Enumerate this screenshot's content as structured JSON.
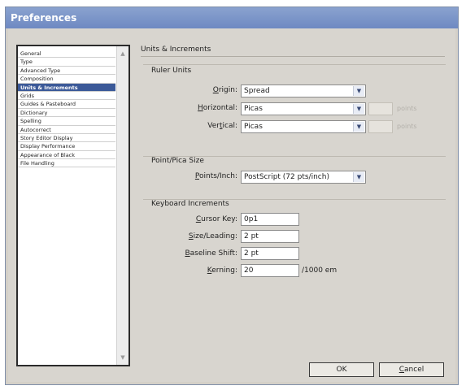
{
  "window": {
    "title": "Preferences"
  },
  "sidebar": {
    "items": [
      "General",
      "Type",
      "Advanced Type",
      "Composition",
      "Units & Increments",
      "Grids",
      "Guides & Pasteboard",
      "Dictionary",
      "Spelling",
      "Autocorrect",
      "Story Editor Display",
      "Display Performance",
      "Appearance of Black",
      "File Handling"
    ],
    "selected": "Units & Increments"
  },
  "panel": {
    "title": "Units & Increments",
    "ruler_units": {
      "title": "Ruler Units",
      "origin_label": "Origin:",
      "origin_value": "Spread",
      "horizontal_label": "Horizontal:",
      "horizontal_value": "Picas",
      "horizontal_points_label": "points",
      "vertical_label": "Vertical:",
      "vertical_value": "Picas",
      "vertical_points_label": "points"
    },
    "point_pica": {
      "title": "Point/Pica Size",
      "points_inch_label": "Points/Inch:",
      "points_inch_value": "PostScript (72 pts/inch)"
    },
    "keyboard": {
      "title": "Keyboard Increments",
      "cursor_key_label": "Cursor Key:",
      "cursor_key_value": "0p1",
      "size_leading_label": "Size/Leading:",
      "size_leading_value": "2 pt",
      "baseline_shift_label": "Baseline Shift:",
      "baseline_shift_value": "2 pt",
      "kerning_label": "Kerning:",
      "kerning_value": "20",
      "kerning_suffix": "/1000 em"
    }
  },
  "buttons": {
    "ok": "OK",
    "cancel": "Cancel"
  },
  "colors": {
    "titlebar": "#7a93c8",
    "selection": "#3b5998",
    "dialog": "#d8d5cf"
  }
}
